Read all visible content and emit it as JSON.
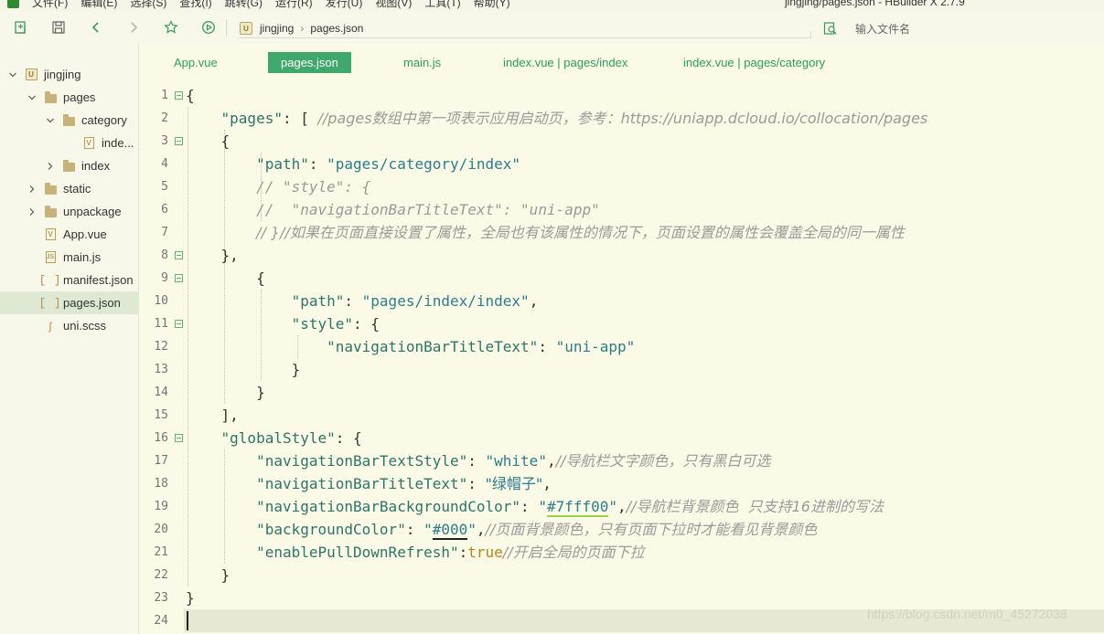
{
  "menubar": {
    "items": [
      "文件(F)",
      "编辑(E)",
      "选择(S)",
      "查找(I)",
      "跳转(G)",
      "运行(R)",
      "发行(U)",
      "视图(V)",
      "工具(T)",
      "帮助(Y)"
    ],
    "window_title": "jingjing/pages.json - HBuilder X 2.7.9"
  },
  "toolbar": {
    "icons": [
      "new-file-icon",
      "save-icon",
      "back-icon",
      "forward-icon",
      "star-icon",
      "run-icon"
    ],
    "breadcrumb": [
      "jingjing",
      "pages.json"
    ],
    "file_search_placeholder": "输入文件名"
  },
  "sidebar": {
    "items": [
      {
        "label": "jingjing",
        "icon": "project-icon",
        "expanded": true
      },
      {
        "label": "pages",
        "icon": "folder-icon",
        "expanded": true
      },
      {
        "label": "category",
        "icon": "folder-icon",
        "expanded": true
      },
      {
        "label": "inde...",
        "icon": "vue-file-icon"
      },
      {
        "label": "index",
        "icon": "folder-icon",
        "expanded": false
      },
      {
        "label": "static",
        "icon": "folder-icon",
        "expanded": false
      },
      {
        "label": "unpackage",
        "icon": "folder-icon",
        "expanded": false
      },
      {
        "label": "App.vue",
        "icon": "vue-file-icon"
      },
      {
        "label": "main.js",
        "icon": "js-file-icon"
      },
      {
        "label": "manifest.json",
        "icon": "json-file-icon"
      },
      {
        "label": "pages.json",
        "icon": "json-file-icon",
        "selected": true
      },
      {
        "label": "uni.scss",
        "icon": "scss-file-icon"
      }
    ]
  },
  "tabs": [
    {
      "label": "App.vue",
      "active": false
    },
    {
      "label": "pages.json",
      "active": true
    },
    {
      "label": "main.js",
      "active": false
    },
    {
      "label": "index.vue | pages/index",
      "active": false
    },
    {
      "label": "index.vue | pages/category",
      "active": false
    }
  ],
  "editor": {
    "line_numbers": [
      "1",
      "2",
      "3",
      "4",
      "5",
      "6",
      "7",
      "8",
      "9",
      "10",
      "11",
      "12",
      "13",
      "14",
      "15",
      "16",
      "17",
      "18",
      "19",
      "20",
      "21",
      "22",
      "23",
      "24"
    ],
    "fold_lines": [
      1,
      3,
      8,
      9,
      11,
      16
    ],
    "current_line": 24,
    "lines": [
      {
        "tokens": [
          {
            "t": "{",
            "c": "punc"
          }
        ]
      },
      {
        "tokens": [
          {
            "t": "    ",
            "c": "punc"
          },
          {
            "t": "\"pages\"",
            "c": "key"
          },
          {
            "t": ": [ ",
            "c": "punc"
          },
          {
            "t": "//pages数组中第一项表示应用启动页，参考：https://uniapp.dcloud.io/collocation/pages",
            "c": "com"
          }
        ]
      },
      {
        "tokens": [
          {
            "t": "    {",
            "c": "punc"
          }
        ]
      },
      {
        "tokens": [
          {
            "t": "        ",
            "c": "punc"
          },
          {
            "t": "\"path\"",
            "c": "key"
          },
          {
            "t": ": ",
            "c": "punc"
          },
          {
            "t": "\"pages/category/index\"",
            "c": "str"
          }
        ]
      },
      {
        "tokens": [
          {
            "t": "        ",
            "c": "punc"
          },
          {
            "t": "// \"style\": {",
            "c": "com"
          }
        ]
      },
      {
        "tokens": [
          {
            "t": "        ",
            "c": "punc"
          },
          {
            "t": "//  \"navigationBarTitleText\": \"uni-app\"",
            "c": "com"
          }
        ]
      },
      {
        "tokens": [
          {
            "t": "        ",
            "c": "punc"
          },
          {
            "t": "// }//如果在页面直接设置了属性，全局也有该属性的情况下，页面设置的属性会覆盖全局的同一属性",
            "c": "com"
          }
        ]
      },
      {
        "tokens": [
          {
            "t": "    },",
            "c": "punc"
          }
        ]
      },
      {
        "tokens": [
          {
            "t": "        {",
            "c": "punc"
          }
        ]
      },
      {
        "tokens": [
          {
            "t": "            ",
            "c": "punc"
          },
          {
            "t": "\"path\"",
            "c": "key"
          },
          {
            "t": ": ",
            "c": "punc"
          },
          {
            "t": "\"pages/index/index\"",
            "c": "str"
          },
          {
            "t": ",",
            "c": "punc"
          }
        ]
      },
      {
        "tokens": [
          {
            "t": "            ",
            "c": "punc"
          },
          {
            "t": "\"style\"",
            "c": "key"
          },
          {
            "t": ": {",
            "c": "punc"
          }
        ]
      },
      {
        "tokens": [
          {
            "t": "                ",
            "c": "punc"
          },
          {
            "t": "\"navigationBarTitleText\"",
            "c": "key"
          },
          {
            "t": ": ",
            "c": "punc"
          },
          {
            "t": "\"uni-app\"",
            "c": "str"
          }
        ]
      },
      {
        "tokens": [
          {
            "t": "            }",
            "c": "punc"
          }
        ]
      },
      {
        "tokens": [
          {
            "t": "        }",
            "c": "punc"
          }
        ]
      },
      {
        "tokens": [
          {
            "t": "    ],",
            "c": "punc"
          }
        ]
      },
      {
        "tokens": [
          {
            "t": "    ",
            "c": "punc"
          },
          {
            "t": "\"globalStyle\"",
            "c": "key"
          },
          {
            "t": ": {",
            "c": "punc"
          }
        ]
      },
      {
        "tokens": [
          {
            "t": "        ",
            "c": "punc"
          },
          {
            "t": "\"navigationBarTextStyle\"",
            "c": "key"
          },
          {
            "t": ": ",
            "c": "punc"
          },
          {
            "t": "\"white\"",
            "c": "str"
          },
          {
            "t": ",",
            "c": "punc"
          },
          {
            "t": "//导航栏文字颜色，只有黑白可选",
            "c": "com"
          }
        ]
      },
      {
        "tokens": [
          {
            "t": "        ",
            "c": "punc"
          },
          {
            "t": "\"navigationBarTitleText\"",
            "c": "key"
          },
          {
            "t": ": ",
            "c": "punc"
          },
          {
            "t": "\"绿帽子\"",
            "c": "str"
          },
          {
            "t": ",",
            "c": "punc"
          }
        ]
      },
      {
        "tokens": [
          {
            "t": "        ",
            "c": "punc"
          },
          {
            "t": "\"navigationBarBackgroundColor\"",
            "c": "key"
          },
          {
            "t": ": ",
            "c": "punc"
          },
          {
            "t": "\"",
            "c": "str"
          },
          {
            "t": "#7fff00",
            "c": "str",
            "u": "green"
          },
          {
            "t": "\"",
            "c": "str"
          },
          {
            "t": ",",
            "c": "punc"
          },
          {
            "t": "//导航栏背景颜色  只支持16进制的写法",
            "c": "com"
          }
        ]
      },
      {
        "tokens": [
          {
            "t": "        ",
            "c": "punc"
          },
          {
            "t": "\"backgroundColor\"",
            "c": "key"
          },
          {
            "t": ": ",
            "c": "punc"
          },
          {
            "t": "\"",
            "c": "str"
          },
          {
            "t": "#000",
            "c": "str",
            "u": "black"
          },
          {
            "t": "\"",
            "c": "str"
          },
          {
            "t": ",",
            "c": "punc"
          },
          {
            "t": "//页面背景颜色，只有页面下拉时才能看见背景颜色",
            "c": "com"
          }
        ]
      },
      {
        "tokens": [
          {
            "t": "        ",
            "c": "punc"
          },
          {
            "t": "\"enablePullDownRefresh\"",
            "c": "key"
          },
          {
            "t": ":",
            "c": "punc"
          },
          {
            "t": "true",
            "c": "bool"
          },
          {
            "t": "//开启全局的页面下拉",
            "c": "com"
          }
        ]
      },
      {
        "tokens": [
          {
            "t": "    }",
            "c": "punc"
          }
        ]
      },
      {
        "tokens": [
          {
            "t": "}",
            "c": "punc"
          }
        ]
      },
      {
        "tokens": []
      }
    ]
  },
  "watermark": "https://blog.csdn.net/m0_45272038",
  "colors": {
    "accent_green": "#3fa86a",
    "tab_text": "#2c9c60",
    "editor_bg": "#fafae6",
    "current_line": "#e8e7d3"
  }
}
